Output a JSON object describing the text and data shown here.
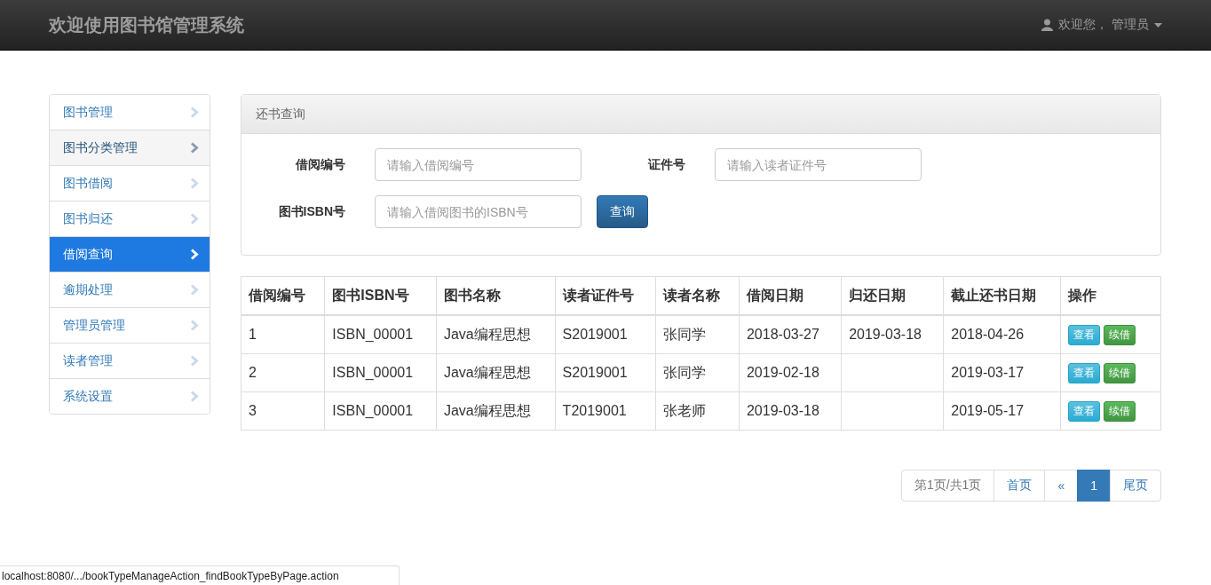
{
  "navbar": {
    "brand": "欢迎使用图书馆管理系统",
    "user": "欢迎您， 管理员"
  },
  "sidebar": {
    "items": [
      {
        "label": "图书管理",
        "selected": false,
        "hovered": false
      },
      {
        "label": "图书分类管理",
        "selected": false,
        "hovered": true
      },
      {
        "label": "图书借阅",
        "selected": false,
        "hovered": false
      },
      {
        "label": "图书归还",
        "selected": false,
        "hovered": false
      },
      {
        "label": "借阅查询",
        "selected": true,
        "hovered": false
      },
      {
        "label": "逾期处理",
        "selected": false,
        "hovered": false
      },
      {
        "label": "管理员管理",
        "selected": false,
        "hovered": false
      },
      {
        "label": "读者管理",
        "selected": false,
        "hovered": false
      },
      {
        "label": "系统设置",
        "selected": false,
        "hovered": false
      }
    ]
  },
  "search_panel": {
    "title": "还书查询",
    "fields": [
      {
        "label": "借阅编号",
        "placeholder": "请输入借阅编号"
      },
      {
        "label": "证件号",
        "placeholder": "请输入读者证件号"
      },
      {
        "label": "图书ISBN号",
        "placeholder": "请输入借阅图书的ISBN号"
      }
    ],
    "button": "查询"
  },
  "table": {
    "columns": [
      "借阅编号",
      "图书ISBN号",
      "图书名称",
      "读者证件号",
      "读者名称",
      "借阅日期",
      "归还日期",
      "截止还书日期",
      "操作"
    ],
    "rows": [
      {
        "cells": [
          "1",
          "ISBN_00001",
          "Java编程思想",
          "S2019001",
          "张同学",
          "2018-03-27",
          "2019-03-18",
          "2018-04-26"
        ],
        "actions": [
          {
            "label": "查看",
            "kind": "info"
          },
          {
            "label": "续借",
            "kind": "success"
          }
        ]
      },
      {
        "cells": [
          "2",
          "ISBN_00001",
          "Java编程思想",
          "S2019001",
          "张同学",
          "2019-02-18",
          "",
          "2019-03-17"
        ],
        "actions": [
          {
            "label": "查看",
            "kind": "info"
          },
          {
            "label": "续借",
            "kind": "success"
          }
        ]
      },
      {
        "cells": [
          "3",
          "ISBN_00001",
          "Java编程思想",
          "T2019001",
          "张老师",
          "2019-03-18",
          "",
          "2019-05-17"
        ],
        "actions": [
          {
            "label": "查看",
            "kind": "info"
          },
          {
            "label": "续借",
            "kind": "success"
          }
        ]
      }
    ]
  },
  "pagination": {
    "items": [
      {
        "label": "第1页/共1页",
        "kind": "info",
        "selected": false
      },
      {
        "label": "首页",
        "kind": "link",
        "selected": false
      },
      {
        "label": "«",
        "kind": "link",
        "selected": false
      },
      {
        "label": "1",
        "kind": "link",
        "selected": true
      },
      {
        "label": "尾页",
        "kind": "link",
        "selected": false
      }
    ]
  },
  "status_bar": {
    "url": "localhost:8080/.../bookTypeManageAction_findBookTypeByPage.action"
  }
}
